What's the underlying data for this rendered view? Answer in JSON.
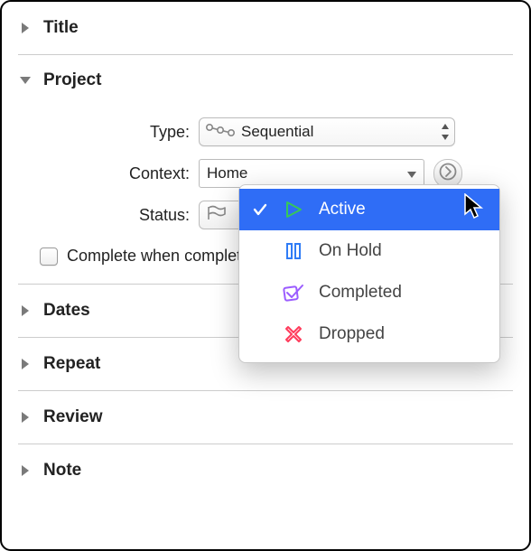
{
  "sections": {
    "title": {
      "label": "Title",
      "expanded": false
    },
    "project": {
      "label": "Project",
      "expanded": true
    },
    "dates": {
      "label": "Dates",
      "expanded": false
    },
    "repeat": {
      "label": "Repeat",
      "expanded": false
    },
    "review": {
      "label": "Review",
      "expanded": false
    },
    "note": {
      "label": "Note",
      "expanded": false
    }
  },
  "project": {
    "type_label": "Type:",
    "type_value": "Sequential",
    "context_label": "Context:",
    "context_value": "Home",
    "status_label": "Status:",
    "complete_checkbox_label": "Complete when completing last action"
  },
  "status_menu": {
    "items": [
      {
        "label": "Active",
        "selected": true
      },
      {
        "label": "On Hold",
        "selected": false
      },
      {
        "label": "Completed",
        "selected": false
      },
      {
        "label": "Dropped",
        "selected": false
      }
    ]
  }
}
